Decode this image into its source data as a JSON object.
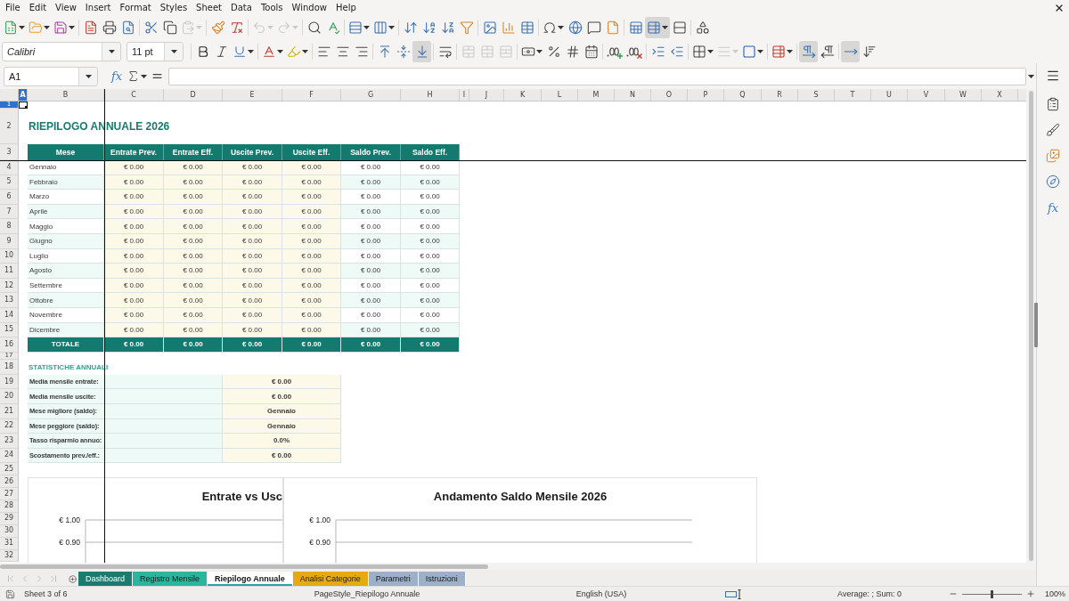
{
  "menu": [
    "File",
    "Edit",
    "View",
    "Insert",
    "Format",
    "Styles",
    "Sheet",
    "Data",
    "Tools",
    "Window",
    "Help"
  ],
  "toolbar_standard": [
    {
      "pressed": false,
      "disabled": false
    },
    {
      "pressed": false,
      "disabled": false
    },
    {
      "pressed": false,
      "disabled": false
    },
    {
      "pressed": false,
      "disabled": false
    },
    {
      "pressed": false,
      "disabled": false
    },
    {
      "pressed": false,
      "disabled": false
    },
    {
      "pressed": false,
      "disabled": false
    },
    {
      "pressed": false,
      "disabled": false
    },
    {
      "pressed": false,
      "disabled": true
    },
    {
      "pressed": false,
      "disabled": false
    },
    {
      "pressed": false,
      "disabled": false
    },
    {
      "pressed": false,
      "disabled": true
    },
    {
      "pressed": false,
      "disabled": true
    },
    {
      "pressed": false,
      "disabled": false
    },
    {
      "pressed": false,
      "disabled": false
    },
    {
      "pressed": false,
      "disabled": false
    },
    {
      "pressed": false,
      "disabled": false
    },
    {
      "pressed": false,
      "disabled": false
    },
    {
      "pressed": false,
      "disabled": false
    },
    {
      "pressed": false,
      "disabled": false
    },
    {
      "pressed": false,
      "disabled": false
    },
    {
      "pressed": false,
      "disabled": false
    },
    {
      "pressed": false,
      "disabled": false
    },
    {
      "pressed": false,
      "disabled": false
    },
    {
      "pressed": false,
      "disabled": false
    },
    {
      "pressed": false,
      "disabled": false
    },
    {
      "pressed": false,
      "disabled": false
    },
    {
      "pressed": false,
      "disabled": false
    },
    {
      "pressed": false,
      "disabled": false
    },
    {
      "pressed": true,
      "disabled": false
    },
    {
      "pressed": false,
      "disabled": false
    },
    {
      "pressed": false,
      "disabled": false
    }
  ],
  "toolbar_formatting": {
    "font_name": "Calibri",
    "font_size": "11 pt",
    "buttons": [
      {
        "pressed": false,
        "disabled": false
      },
      {
        "pressed": false,
        "disabled": false
      },
      {
        "pressed": false,
        "disabled": false
      },
      {
        "pressed": false,
        "disabled": false
      },
      {
        "pressed": false,
        "disabled": false
      },
      {
        "pressed": false,
        "disabled": false
      },
      {
        "pressed": false,
        "disabled": false
      },
      {
        "pressed": false,
        "disabled": false
      },
      {
        "pressed": false,
        "disabled": false
      },
      {
        "pressed": false,
        "disabled": false
      },
      {
        "pressed": true,
        "disabled": false
      },
      {
        "pressed": false,
        "disabled": false
      },
      {
        "pressed": false,
        "disabled": true
      },
      {
        "pressed": false,
        "disabled": true
      },
      {
        "pressed": false,
        "disabled": true
      },
      {
        "pressed": false,
        "disabled": false
      },
      {
        "pressed": false,
        "disabled": false
      },
      {
        "pressed": false,
        "disabled": false
      },
      {
        "pressed": false,
        "disabled": false
      },
      {
        "pressed": false,
        "disabled": false
      },
      {
        "pressed": false,
        "disabled": false
      },
      {
        "pressed": false,
        "disabled": false
      },
      {
        "pressed": false,
        "disabled": false
      },
      {
        "pressed": false,
        "disabled": false
      },
      {
        "pressed": false,
        "disabled": true
      },
      {
        "pressed": false,
        "disabled": false
      },
      {
        "pressed": false,
        "disabled": false
      },
      {
        "pressed": true,
        "disabled": false
      },
      {
        "pressed": false,
        "disabled": false
      },
      {
        "pressed": true,
        "disabled": false
      },
      {
        "pressed": false,
        "disabled": false
      }
    ]
  },
  "formula_bar": {
    "name_box": "A1",
    "function_wizard": "fx"
  },
  "sidebar": {
    "functions_button": "fx"
  },
  "sheet": {
    "column_headers": [
      {
        "label": "A",
        "selected": true
      },
      {
        "label": "B",
        "selected": false
      },
      {
        "label": "C",
        "selected": false
      },
      {
        "label": "D",
        "selected": false
      },
      {
        "label": "E",
        "selected": false
      },
      {
        "label": "F",
        "selected": false
      },
      {
        "label": "G",
        "selected": false
      },
      {
        "label": "H",
        "selected": false
      },
      {
        "label": "I",
        "selected": false
      },
      {
        "label": "J",
        "selected": false
      },
      {
        "label": "K",
        "selected": false
      },
      {
        "label": "L",
        "selected": false
      },
      {
        "label": "M",
        "selected": false
      },
      {
        "label": "N",
        "selected": false
      },
      {
        "label": "O",
        "selected": false
      },
      {
        "label": "P",
        "selected": false
      },
      {
        "label": "Q",
        "selected": false
      },
      {
        "label": "R",
        "selected": false
      },
      {
        "label": "S",
        "selected": false
      },
      {
        "label": "T",
        "selected": false
      },
      {
        "label": "U",
        "selected": false
      },
      {
        "label": "V",
        "selected": false
      },
      {
        "label": "W",
        "selected": false
      },
      {
        "label": "X",
        "selected": false
      }
    ],
    "row_headers": [
      {
        "label": "1",
        "selected": true
      },
      {
        "label": "2",
        "selected": false
      },
      {
        "label": "3",
        "selected": false
      },
      {
        "label": "4",
        "selected": false
      },
      {
        "label": "5",
        "selected": false
      },
      {
        "label": "6",
        "selected": false
      },
      {
        "label": "7",
        "selected": false
      },
      {
        "label": "8",
        "selected": false
      },
      {
        "label": "9",
        "selected": false
      },
      {
        "label": "10",
        "selected": false
      },
      {
        "label": "11",
        "selected": false
      },
      {
        "label": "12",
        "selected": false
      },
      {
        "label": "13",
        "selected": false
      },
      {
        "label": "14",
        "selected": false
      },
      {
        "label": "15",
        "selected": false
      },
      {
        "label": "16",
        "selected": false
      },
      {
        "label": "17",
        "selected": false
      },
      {
        "label": "18",
        "selected": false
      },
      {
        "label": "19",
        "selected": false
      },
      {
        "label": "20",
        "selected": false
      },
      {
        "label": "21",
        "selected": false
      },
      {
        "label": "22",
        "selected": false
      },
      {
        "label": "23",
        "selected": false
      },
      {
        "label": "24",
        "selected": false
      },
      {
        "label": "25",
        "selected": false
      },
      {
        "label": "26",
        "selected": false
      },
      {
        "label": "27",
        "selected": false
      },
      {
        "label": "28",
        "selected": false
      },
      {
        "label": "29",
        "selected": false
      },
      {
        "label": "30",
        "selected": false
      },
      {
        "label": "31",
        "selected": false
      },
      {
        "label": "32",
        "selected": false
      }
    ],
    "title": "RIEPILOGO ANNUALE 2026",
    "table": {
      "columns": [
        "Mese",
        "Entrate Prev.",
        "Entrate Eff.",
        "Uscite Prev.",
        "Uscite Eff.",
        "Saldo Prev.",
        "Saldo Eff."
      ],
      "rows": [
        {
          "month": "Gennaio",
          "values": [
            "€ 0.00",
            "€ 0.00",
            "€ 0.00",
            "€ 0.00",
            "€ 0.00",
            "€ 0.00"
          ]
        },
        {
          "month": "Febbraio",
          "values": [
            "€ 0.00",
            "€ 0.00",
            "€ 0.00",
            "€ 0.00",
            "€ 0.00",
            "€ 0.00"
          ]
        },
        {
          "month": "Marzo",
          "values": [
            "€ 0.00",
            "€ 0.00",
            "€ 0.00",
            "€ 0.00",
            "€ 0.00",
            "€ 0.00"
          ]
        },
        {
          "month": "Aprile",
          "values": [
            "€ 0.00",
            "€ 0.00",
            "€ 0.00",
            "€ 0.00",
            "€ 0.00",
            "€ 0.00"
          ]
        },
        {
          "month": "Maggio",
          "values": [
            "€ 0.00",
            "€ 0.00",
            "€ 0.00",
            "€ 0.00",
            "€ 0.00",
            "€ 0.00"
          ]
        },
        {
          "month": "Giugno",
          "values": [
            "€ 0.00",
            "€ 0.00",
            "€ 0.00",
            "€ 0.00",
            "€ 0.00",
            "€ 0.00"
          ]
        },
        {
          "month": "Luglio",
          "values": [
            "€ 0.00",
            "€ 0.00",
            "€ 0.00",
            "€ 0.00",
            "€ 0.00",
            "€ 0.00"
          ]
        },
        {
          "month": "Agosto",
          "values": [
            "€ 0.00",
            "€ 0.00",
            "€ 0.00",
            "€ 0.00",
            "€ 0.00",
            "€ 0.00"
          ]
        },
        {
          "month": "Settembre",
          "values": [
            "€ 0.00",
            "€ 0.00",
            "€ 0.00",
            "€ 0.00",
            "€ 0.00",
            "€ 0.00"
          ]
        },
        {
          "month": "Ottobre",
          "values": [
            "€ 0.00",
            "€ 0.00",
            "€ 0.00",
            "€ 0.00",
            "€ 0.00",
            "€ 0.00"
          ]
        },
        {
          "month": "Novembre",
          "values": [
            "€ 0.00",
            "€ 0.00",
            "€ 0.00",
            "€ 0.00",
            "€ 0.00",
            "€ 0.00"
          ]
        },
        {
          "month": "Dicembre",
          "values": [
            "€ 0.00",
            "€ 0.00",
            "€ 0.00",
            "€ 0.00",
            "€ 0.00",
            "€ 0.00"
          ]
        }
      ],
      "total": {
        "label": "TOTALE",
        "values": [
          "€ 0.00",
          "€ 0.00",
          "€ 0.00",
          "€ 0.00",
          "€ 0.00",
          "€ 0.00"
        ]
      }
    },
    "stats": {
      "title": "STATISTICHE ANNUALI",
      "rows": [
        {
          "label": "Media mensile entrate:",
          "value": "€ 0.00"
        },
        {
          "label": "Media mensile uscite:",
          "value": "€ 0.00"
        },
        {
          "label": "Mese migliore (saldo):",
          "value": "Gennaio"
        },
        {
          "label": "Mese peggiore (saldo):",
          "value": "Gennaio"
        },
        {
          "label": "Tasso risparmio annuo:",
          "value": "0.0%"
        },
        {
          "label": "Scostamento prev./eff.:",
          "value": "€ 0.00"
        }
      ]
    },
    "charts": [
      {
        "title": "Entrate vs Usc",
        "axis_labels": [
          "€ 1.00",
          "€ 0.90"
        ]
      },
      {
        "title": "Andamento Saldo Mensile 2026",
        "axis_labels": [
          "€ 1.00",
          "€ 0.90"
        ]
      }
    ]
  },
  "sheet_tabs": {
    "nav": [
      {
        "disabled": true
      },
      {
        "disabled": true
      },
      {
        "disabled": true
      },
      {
        "disabled": true
      }
    ],
    "tabs": [
      {
        "label": "Dashboard",
        "color": "#1b7b6f",
        "selected": false
      },
      {
        "label": "Registro Mensile",
        "color": "#2bb59c",
        "selected": false
      },
      {
        "label": "Riepilogo Annuale",
        "color": "#26a69a",
        "selected": true
      },
      {
        "label": "Analisi Categorie",
        "color": "#e5a911",
        "selected": false
      },
      {
        "label": "Parametri",
        "color": "#9eb0c8",
        "selected": false
      },
      {
        "label": "Istruzioni",
        "color": "#9eb0c8",
        "selected": false
      }
    ]
  },
  "status_bar": {
    "sheet": "Sheet 3 of 6",
    "page_style": "PageStyle_Riepilogo Annuale",
    "language": "English (USA)",
    "summary": "Average: ; Sum: 0",
    "zoom": {
      "level": 0.5,
      "reading": "100%"
    }
  }
}
